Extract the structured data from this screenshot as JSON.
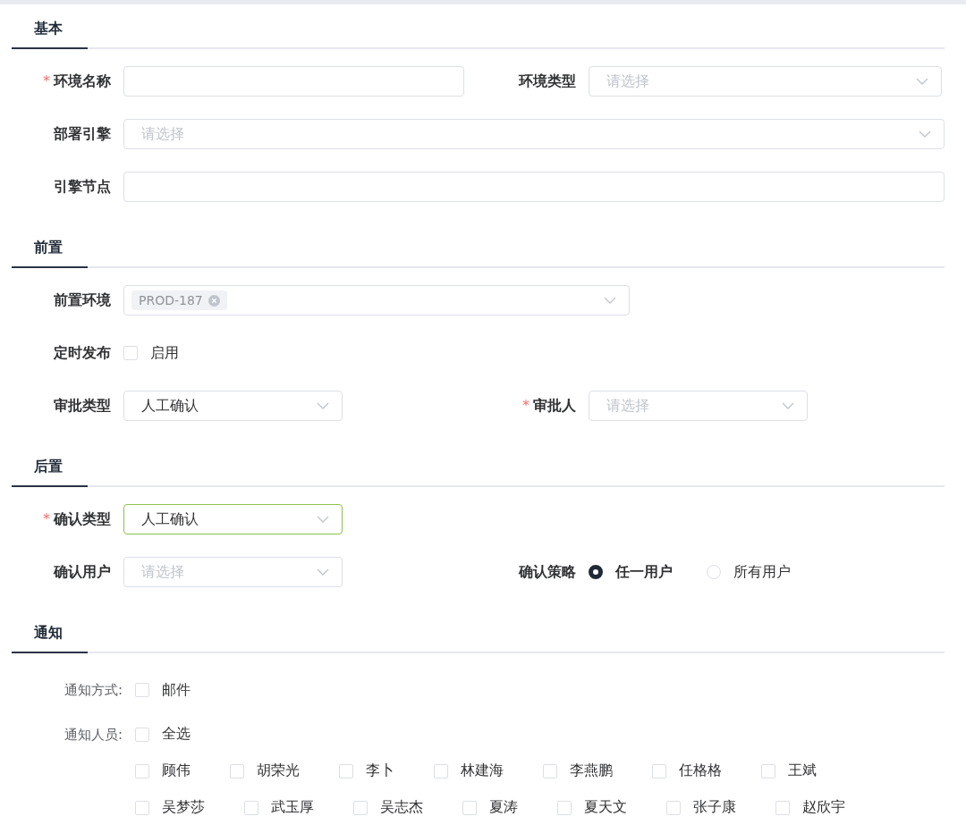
{
  "required_mark": "*",
  "sections": [
    {
      "title": "基本",
      "rows": [
        [
          {
            "kind": "input",
            "label": "环境名称",
            "required": true
          },
          {
            "kind": "select",
            "label": "环境类型",
            "required": false,
            "placeholder": "请选择",
            "focused": false
          }
        ],
        [
          {
            "kind": "select",
            "label": "部署引擎",
            "required": false,
            "placeholder": "请选择",
            "focused": false
          }
        ],
        [
          {
            "kind": "input",
            "label": "引擎节点",
            "required": false
          }
        ]
      ]
    },
    {
      "title": "前置",
      "rows": [
        [
          {
            "kind": "tags",
            "label": "前置环境",
            "required": false,
            "tags": [
              "PROD-187"
            ]
          }
        ],
        [
          {
            "kind": "checkbox",
            "label": "定时发布",
            "required": false,
            "lines": [
              [
                {
                  "label": "启用",
                  "checked": false
                }
              ]
            ]
          }
        ],
        [
          {
            "kind": "select",
            "label": "审批类型",
            "required": false,
            "value": "人工确认",
            "focused": false
          },
          {
            "kind": "select",
            "label": "审批人",
            "required": true,
            "placeholder": "请选择",
            "focused": false
          }
        ]
      ]
    },
    {
      "title": "后置",
      "rows": [
        [
          {
            "kind": "select",
            "label": "确认类型",
            "required": true,
            "value": "人工确认",
            "focused": true
          }
        ],
        [
          {
            "kind": "select",
            "label": "确认用户",
            "required": false,
            "placeholder": "请选择",
            "focused": false
          },
          {
            "kind": "radio",
            "label": "确认策略",
            "required": false,
            "options": [
              {
                "label": "任一用户",
                "selected": true
              },
              {
                "label": "所有用户",
                "selected": false
              }
            ]
          }
        ]
      ]
    },
    {
      "title": "通知",
      "rows": [
        [
          {
            "kind": "checklist",
            "label": "通知方式:",
            "required": false,
            "lines": [
              [
                {
                  "label": "邮件",
                  "checked": false
                }
              ]
            ]
          }
        ],
        [
          {
            "kind": "checklist",
            "label": "通知人员:",
            "required": false,
            "lines": [
              [
                {
                  "label": "全选",
                  "checked": false
                }
              ],
              [
                {
                  "label": "顾伟",
                  "checked": false
                },
                {
                  "label": "胡荣光",
                  "checked": false
                },
                {
                  "label": "李卜",
                  "checked": false
                },
                {
                  "label": "林建海",
                  "checked": false
                },
                {
                  "label": "李燕鹏",
                  "checked": false
                },
                {
                  "label": "任格格",
                  "checked": false
                },
                {
                  "label": "王斌",
                  "checked": false
                }
              ],
              [
                {
                  "label": "吴梦莎",
                  "checked": false
                },
                {
                  "label": "武玉厚",
                  "checked": false
                },
                {
                  "label": "吴志杰",
                  "checked": false
                },
                {
                  "label": "夏涛",
                  "checked": false
                },
                {
                  "label": "夏天文",
                  "checked": false
                },
                {
                  "label": "张子康",
                  "checked": false
                },
                {
                  "label": "赵欣宇",
                  "checked": false
                }
              ]
            ]
          }
        ]
      ]
    }
  ]
}
